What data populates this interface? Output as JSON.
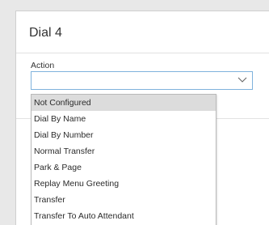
{
  "panel": {
    "title": "Dial 4"
  },
  "action": {
    "label": "Action",
    "value": "",
    "options": [
      {
        "label": "Not Configured",
        "selected": true
      },
      {
        "label": "Dial By Name",
        "selected": false
      },
      {
        "label": "Dial By Number",
        "selected": false
      },
      {
        "label": "Normal Transfer",
        "selected": false
      },
      {
        "label": "Park & Page",
        "selected": false
      },
      {
        "label": "Replay Menu Greeting",
        "selected": false
      },
      {
        "label": "Transfer",
        "selected": false
      },
      {
        "label": "Transfer To Auto Attendant",
        "selected": false
      }
    ]
  },
  "colors": {
    "select_border": "#7fb2dc",
    "highlight": "#dcdcdc"
  }
}
